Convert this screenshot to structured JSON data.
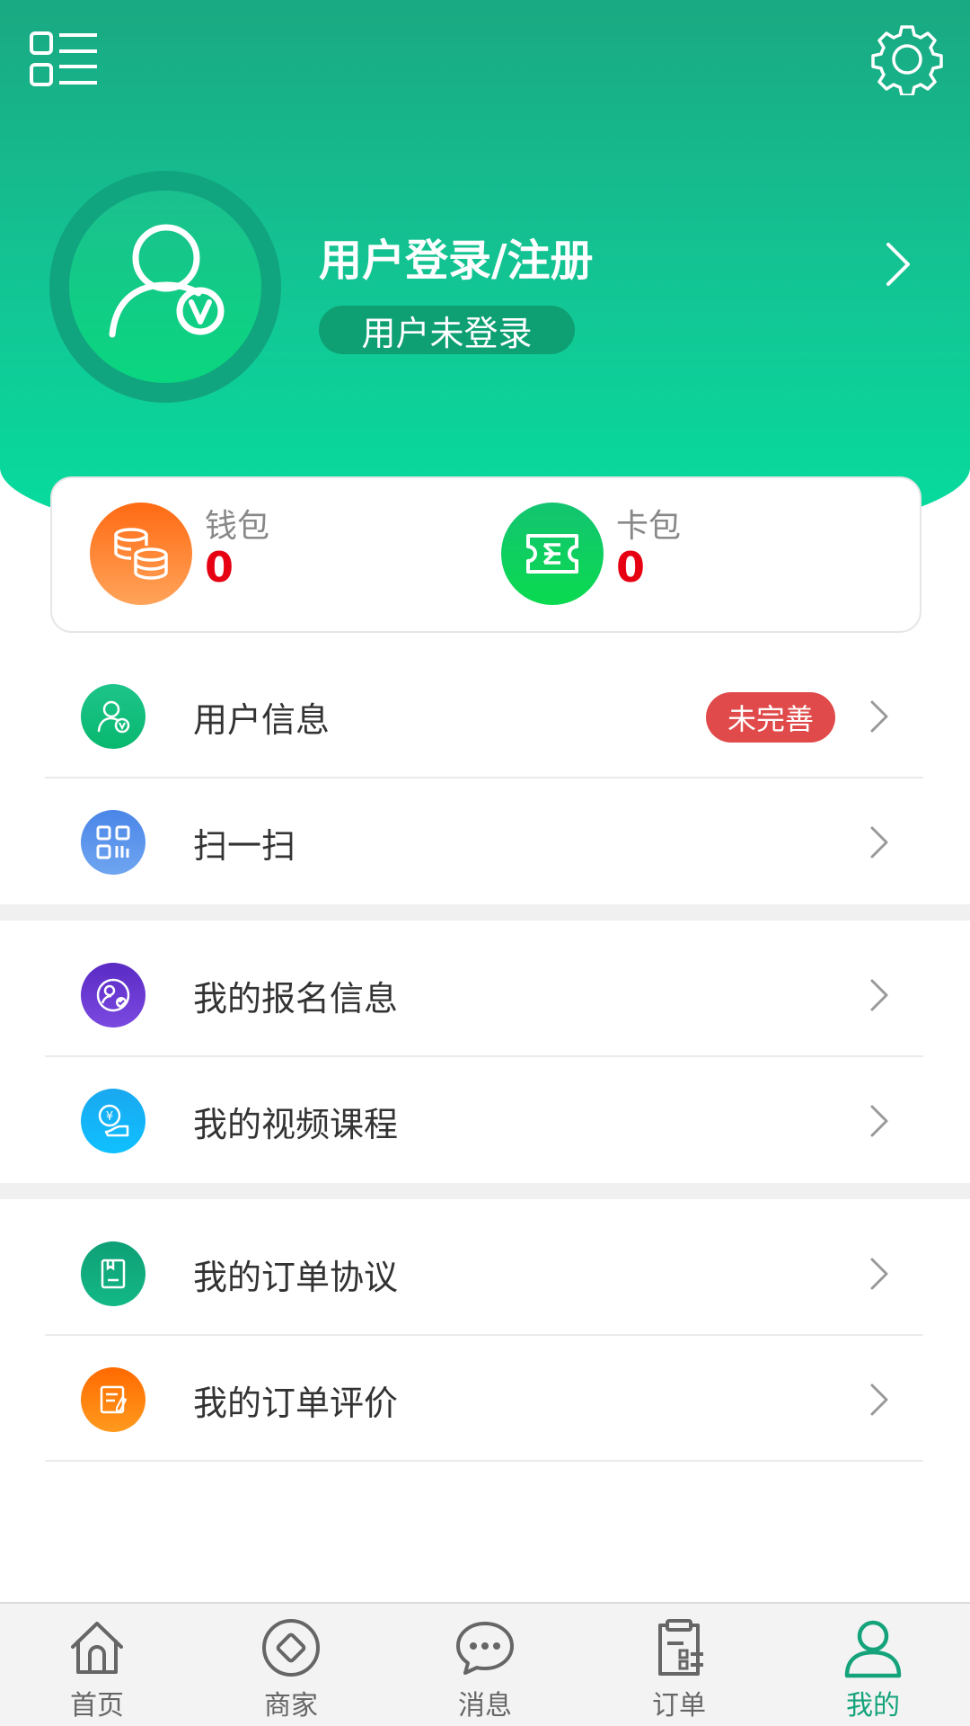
{
  "header": {
    "login_title": "用户登录/注册",
    "login_status": "用户未登录"
  },
  "wallet": {
    "items": [
      {
        "label": "钱包",
        "value": "0",
        "icon": "coins-icon"
      },
      {
        "label": "卡包",
        "value": "0",
        "icon": "ticket-icon"
      }
    ]
  },
  "menu": {
    "items": [
      {
        "label": "用户信息",
        "badge": "未完善",
        "icon": "user-info-icon"
      },
      {
        "label": "扫一扫",
        "icon": "qr-scan-icon"
      },
      {
        "label": "我的报名信息",
        "icon": "registration-icon"
      },
      {
        "label": "我的视频课程",
        "icon": "video-course-icon"
      },
      {
        "label": "我的订单协议",
        "icon": "order-agreement-icon"
      },
      {
        "label": "我的订单评价",
        "icon": "order-review-icon"
      }
    ]
  },
  "nav": {
    "items": [
      {
        "label": "首页",
        "icon": "home-icon"
      },
      {
        "label": "商家",
        "icon": "merchant-icon"
      },
      {
        "label": "消息",
        "icon": "message-icon"
      },
      {
        "label": "订单",
        "icon": "order-icon"
      },
      {
        "label": "我的",
        "icon": "profile-icon",
        "active": true
      }
    ]
  },
  "colors": {
    "primary": "#14a37b",
    "accent_red": "#e60012",
    "badge_red": "#e04a4a"
  }
}
